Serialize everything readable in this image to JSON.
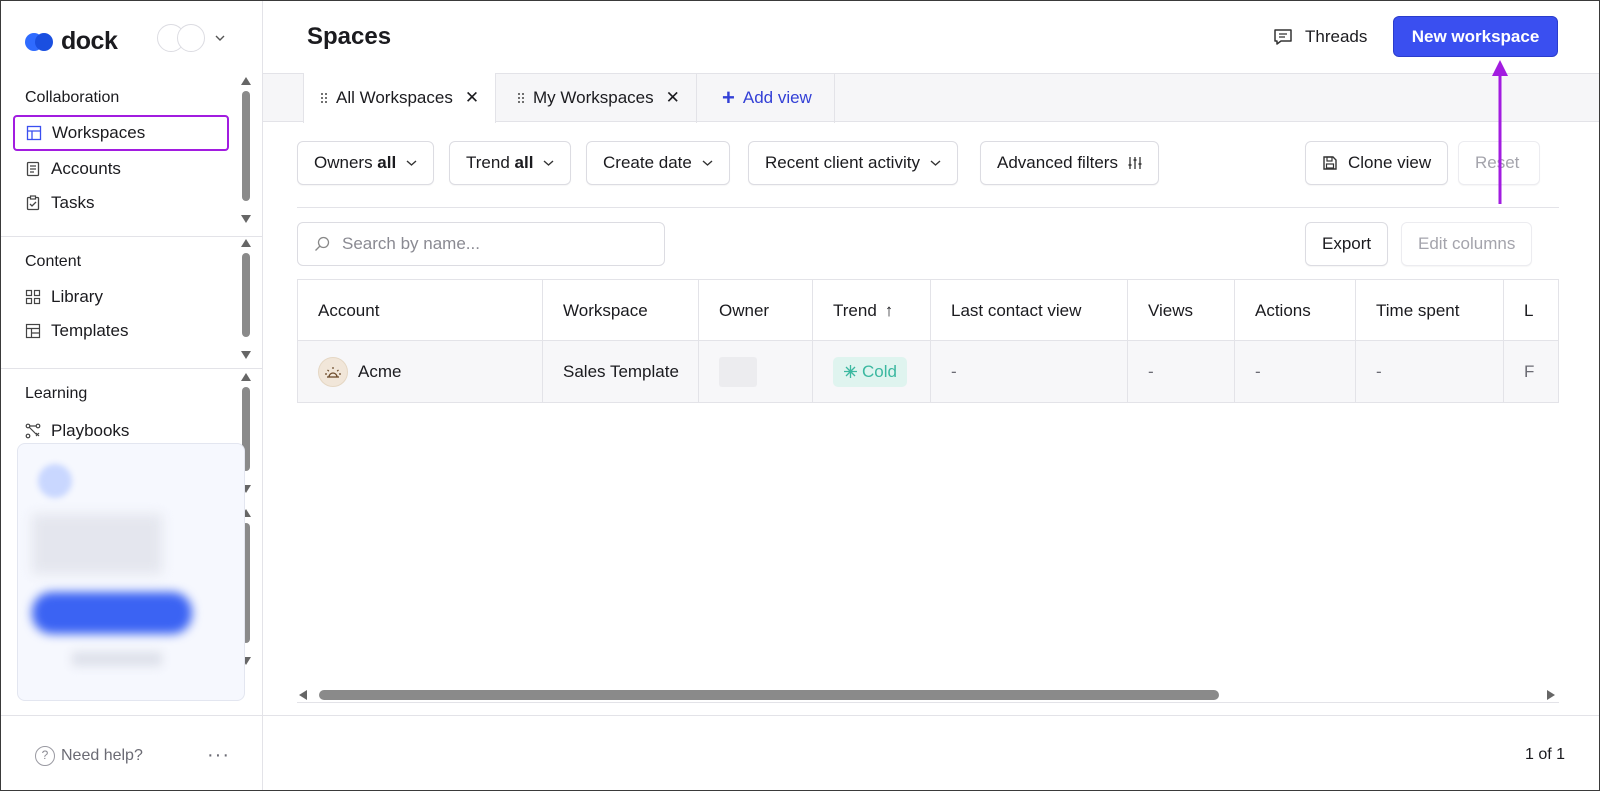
{
  "app": {
    "logo_text": "dock"
  },
  "sidebar": {
    "sections": [
      {
        "title": "Collaboration",
        "items": [
          {
            "label": "Workspaces",
            "icon": "workspaces-icon",
            "active": true
          },
          {
            "label": "Accounts",
            "icon": "accounts-icon"
          },
          {
            "label": "Tasks",
            "icon": "tasks-icon"
          }
        ]
      },
      {
        "title": "Content",
        "items": [
          {
            "label": "Library",
            "icon": "library-icon"
          },
          {
            "label": "Templates",
            "icon": "templates-icon"
          }
        ]
      },
      {
        "title": "Learning",
        "items": [
          {
            "label": "Playbooks",
            "icon": "playbooks-icon"
          }
        ]
      }
    ],
    "help_label": "Need help?",
    "more_label": "···"
  },
  "header": {
    "title": "Spaces",
    "threads_label": "Threads",
    "new_workspace_label": "New workspace"
  },
  "views": {
    "tabs": [
      {
        "label": "All Workspaces",
        "active": true
      },
      {
        "label": "My Workspaces",
        "active": false
      }
    ],
    "add_view_label": "Add view"
  },
  "filters": {
    "owners_prefix": "Owners ",
    "owners_value": "all",
    "trend_prefix": "Trend ",
    "trend_value": "all",
    "create_date": "Create date",
    "recent_activity": "Recent client activity",
    "advanced": "Advanced filters",
    "clone_view": "Clone view",
    "reset": "Reset"
  },
  "search": {
    "placeholder": "Search by name..."
  },
  "table_actions": {
    "export": "Export",
    "edit_columns": "Edit columns"
  },
  "table": {
    "columns": [
      "Account",
      "Workspace",
      "Owner",
      "Trend",
      "Last contact view",
      "Views",
      "Actions",
      "Time spent",
      "L"
    ],
    "trend_sort_indicator": "↑",
    "rows": [
      {
        "account": "Acme",
        "workspace": "Sales Template",
        "owner": "",
        "trend": "Cold",
        "last_contact_view": "-",
        "views": "-",
        "actions": "-",
        "time_spent": "-",
        "last": "F"
      }
    ]
  },
  "pagination": {
    "text": "1 of 1"
  },
  "colors": {
    "accent": "#3a4ff0",
    "highlight": "#a21ce0",
    "cold": "#3bb8a0"
  }
}
